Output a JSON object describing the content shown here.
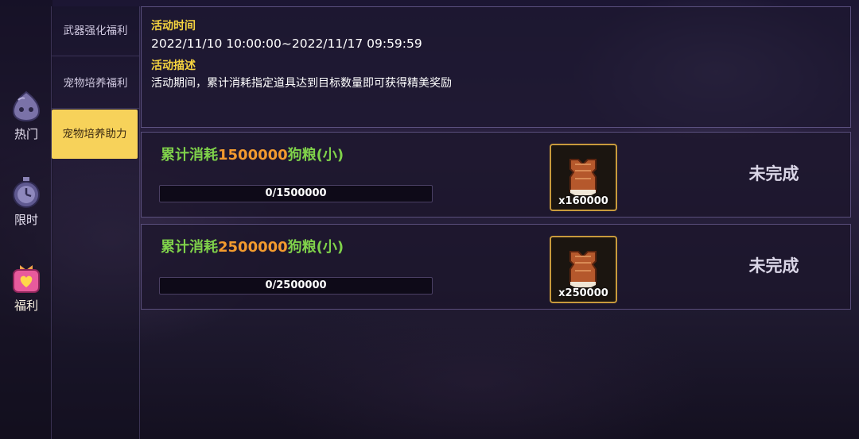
{
  "categories": [
    {
      "label": "热门",
      "icon": "slime-icon"
    },
    {
      "label": "限时",
      "icon": "stopwatch-icon"
    },
    {
      "label": "福利",
      "icon": "gift-heart-icon"
    }
  ],
  "subtabs": [
    {
      "label": "武器强化福利"
    },
    {
      "label": "宠物培养福利"
    },
    {
      "label": "宠物培养助力"
    }
  ],
  "active_subtab": 2,
  "info": {
    "time_heading": "活动时间",
    "time_value": "2022/11/10 10:00:00~2022/11/17 09:59:59",
    "desc_heading": "活动描述",
    "desc_value": "活动期间，累计消耗指定道具达到目标数量即可获得精美奖励"
  },
  "tasks": [
    {
      "prefix": "累计消耗",
      "amount": "1500000",
      "suffix": "狗粮(小)",
      "progress_text": "0/1500000",
      "progress": 0,
      "reward_icon": "pet-vest-icon",
      "reward_count": "x160000",
      "status": "未完成"
    },
    {
      "prefix": "累计消耗",
      "amount": "2500000",
      "suffix": "狗粮(小)",
      "progress_text": "0/2500000",
      "progress": 0,
      "reward_icon": "pet-vest-icon",
      "reward_count": "x250000",
      "status": "未完成"
    }
  ],
  "colors": {
    "accent_yellow": "#f7d25a",
    "heading_yellow": "#f5d33f",
    "task_green": "#7fd14a",
    "task_orange": "#f29a2e",
    "reward_border": "#c89a3c"
  }
}
